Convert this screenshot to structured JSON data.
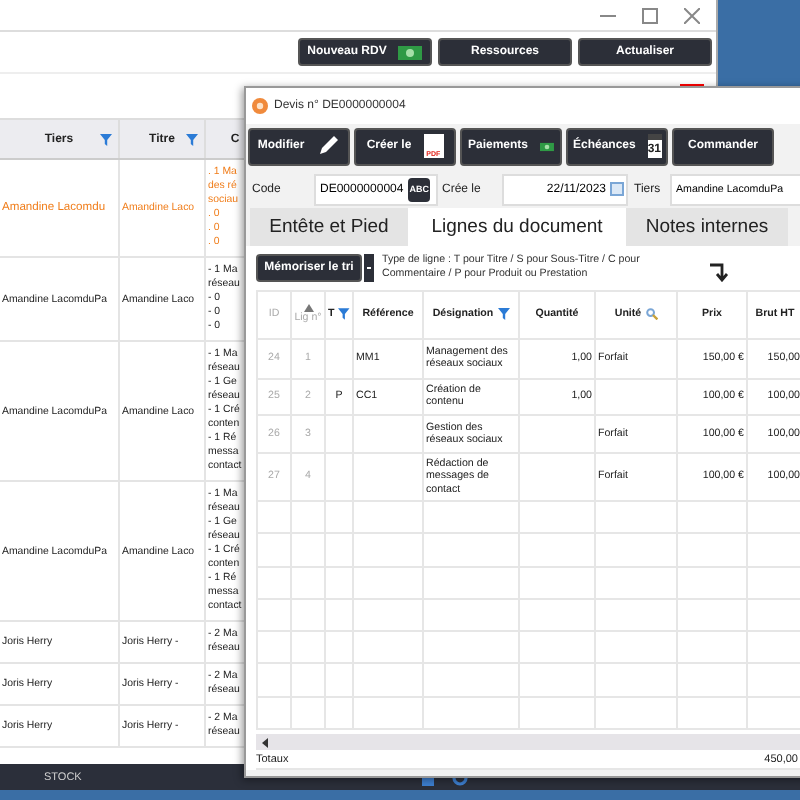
{
  "main_window": {
    "toolbar": [
      {
        "label": "Nouveau RDV",
        "kind": "money"
      },
      {
        "label": "Ressources",
        "kind": "plain"
      },
      {
        "label": "Actualiser",
        "kind": "plain"
      }
    ],
    "table": {
      "columns": [
        {
          "label": "Tiers",
          "filter": true
        },
        {
          "label": "Titre",
          "filter": true
        },
        {
          "label": "C"
        }
      ],
      "rows": [
        {
          "selected": true,
          "tiers": "Amandine Lacomdu",
          "titre": "Amandine Laco",
          "column_3": [
            ". 1 Ma",
            "des ré",
            "sociau",
            ". 0",
            ". 0",
            ". 0"
          ]
        },
        {
          "selected": false,
          "tiers": "Amandine LacomduPa",
          "titre": "Amandine Laco",
          "column_3": [
            "- 1 Ma",
            "réseau",
            "- 0",
            "- 0",
            "- 0"
          ]
        },
        {
          "selected": false,
          "tiers": "Amandine LacomduPa",
          "titre": "Amandine Laco",
          "column_3": [
            "- 1 Ma",
            "réseau",
            "- 1 Ge",
            "réseau",
            "- 1 Cré",
            "conten",
            "- 1 Ré",
            "messa",
            "contact"
          ]
        },
        {
          "selected": false,
          "tiers": "Amandine LacomduPa",
          "titre": "Amandine Laco",
          "column_3": [
            "- 1 Ma",
            "réseau",
            "- 1 Ge",
            "réseau",
            "- 1 Cré",
            "conten",
            "- 1 Ré",
            "messa",
            "contact"
          ]
        },
        {
          "selected": false,
          "tiers": "Joris Herry",
          "titre": "Joris Herry -",
          "column_3": [
            "- 2 Ma",
            "réseau"
          ]
        },
        {
          "selected": false,
          "tiers": "Joris Herry",
          "titre": "Joris Herry -",
          "column_3": [
            "- 2 Ma",
            "réseau"
          ]
        },
        {
          "selected": false,
          "tiers": "Joris Herry",
          "titre": "Joris Herry -",
          "column_3": [
            "- 2 Ma",
            "réseau"
          ]
        }
      ]
    }
  },
  "dialog": {
    "title": "Devis n° DE0000000004",
    "toolbar": [
      {
        "label": "Modifier",
        "kind": "edit"
      },
      {
        "label": "Créer le",
        "kind": "pdf",
        "icon_text": "PDF"
      },
      {
        "label": "Paiements",
        "kind": "money"
      },
      {
        "label": "Échéances",
        "kind": "calendar",
        "icon_text": "31"
      },
      {
        "label": "Commander",
        "kind": "plain"
      }
    ],
    "fields": [
      {
        "label": "Code",
        "value": "DE0000000004",
        "kind": "code",
        "button": "ABC"
      },
      {
        "label": "Crée le",
        "value": "22/11/2023",
        "kind": "date"
      },
      {
        "label": "Tiers",
        "value": "Amandine LacomduPa",
        "kind": "text"
      }
    ],
    "tabs": [
      {
        "label": "Entête et Pied",
        "selected": false
      },
      {
        "label": "Lignes du document",
        "selected": true
      },
      {
        "label": "Notes internes",
        "selected": false
      }
    ],
    "sort_button": "Mémoriser le tri",
    "help": "Type de ligne : T pour Titre / S pour Sous-Titre  / C pour Commentaire /  P pour Produit ou Prestation",
    "grid": {
      "columns": [
        {
          "label": "ID",
          "filter": false,
          "sorted": false,
          "search": false
        },
        {
          "label": "Lig n°",
          "filter": false,
          "sorted": true,
          "search": false
        },
        {
          "label": "T",
          "filter": true,
          "sorted": false,
          "search": false
        },
        {
          "label": "Référence",
          "filter": false,
          "sorted": false,
          "search": false
        },
        {
          "label": "Désignation",
          "filter": true,
          "sorted": false,
          "search": false
        },
        {
          "label": "Quantité",
          "filter": false,
          "sorted": false,
          "search": false
        },
        {
          "label": "Unité",
          "filter": false,
          "sorted": false,
          "search": true
        },
        {
          "label": "Prix",
          "filter": false,
          "sorted": false,
          "search": false
        },
        {
          "label": "Brut HT",
          "filter": false,
          "sorted": false,
          "search": false
        }
      ],
      "rows": [
        {
          "id": "24",
          "line": "1",
          "ref": "MM1",
          "designation": "Management des réseaux sociaux",
          "quantity": "1,00",
          "unit": "Forfait",
          "price": "150,00 €",
          "brut": "150,00"
        },
        {
          "id": "25",
          "line": "2",
          "type": "P",
          "ref": "CC1",
          "designation": "Création de contenu",
          "quantity": "1,00",
          "price": "100,00 €",
          "brut": "100,00"
        },
        {
          "id": "26",
          "line": "3",
          "designation": "Gestion des réseaux sociaux",
          "unit": "Forfait",
          "price": "100,00 €",
          "brut": "100,00"
        },
        {
          "id": "27",
          "line": "4",
          "designation": "Rédaction de messages de contact",
          "unit": "Forfait",
          "price": "100,00 €",
          "brut": "100,00"
        }
      ],
      "totals": {
        "label": "Totaux",
        "value": "450,00"
      }
    }
  },
  "taskbar": {
    "label": "STOCK"
  }
}
